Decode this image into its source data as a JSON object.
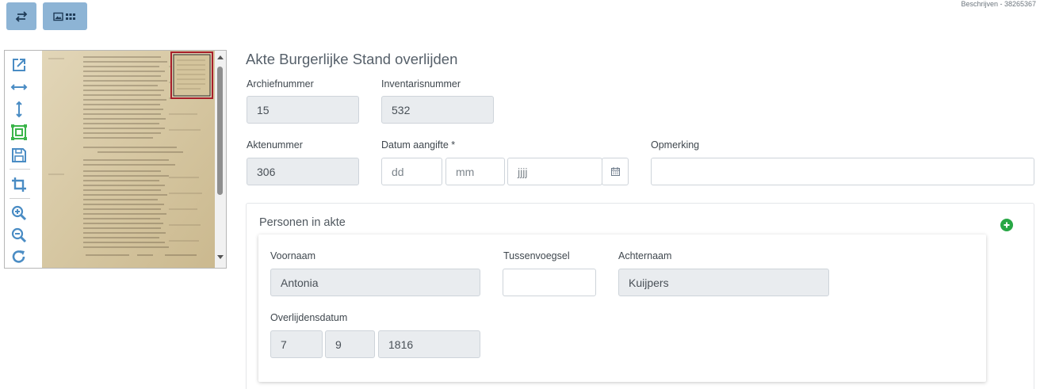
{
  "header": {
    "reference": "Beschrijven - 38265367",
    "swap_icon": "swap-arrows-icon",
    "grid_icon": "image-grid-icon"
  },
  "viewer": {
    "tools": [
      "external-link-icon",
      "fit-width-icon",
      "fit-height-icon",
      "fit-page-icon",
      "save-icon",
      "crop-icon",
      "zoom-in-icon",
      "zoom-out-icon",
      "rotate-icon"
    ],
    "image_alt": "scan-icon"
  },
  "form": {
    "title": "Akte Burgerlijke Stand overlijden",
    "archiefnummer": {
      "label": "Archiefnummer",
      "value": "15"
    },
    "inventarisnummer": {
      "label": "Inventarisnummer",
      "value": "532"
    },
    "aktenummer": {
      "label": "Aktenummer",
      "value": "306"
    },
    "datum_aangifte": {
      "label": "Datum aangifte *",
      "day_placeholder": "dd",
      "month_placeholder": "mm",
      "year_placeholder": "jjjj",
      "calendar_icon": "calendar-icon"
    },
    "opmerking": {
      "label": "Opmerking",
      "value": ""
    }
  },
  "personen": {
    "title": "Personen in akte",
    "add_icon": "plus-circle-icon",
    "person": {
      "voornaam_label": "Voornaam",
      "voornaam": "Antonia",
      "tussenvoegsel_label": "Tussenvoegsel",
      "tussenvoegsel": "",
      "achternaam_label": "Achternaam",
      "achternaam": "Kuijpers",
      "overlijdensdatum_label": "Overlijdensdatum",
      "dag": "7",
      "maand": "9",
      "jaar": "1816"
    }
  },
  "colors": {
    "top_button": "#8db4d5",
    "tool_icon": "#4a8cc4",
    "tool_active": "#3bb54a",
    "add_button": "#28a745",
    "readonly_bg": "#e9ecef"
  }
}
